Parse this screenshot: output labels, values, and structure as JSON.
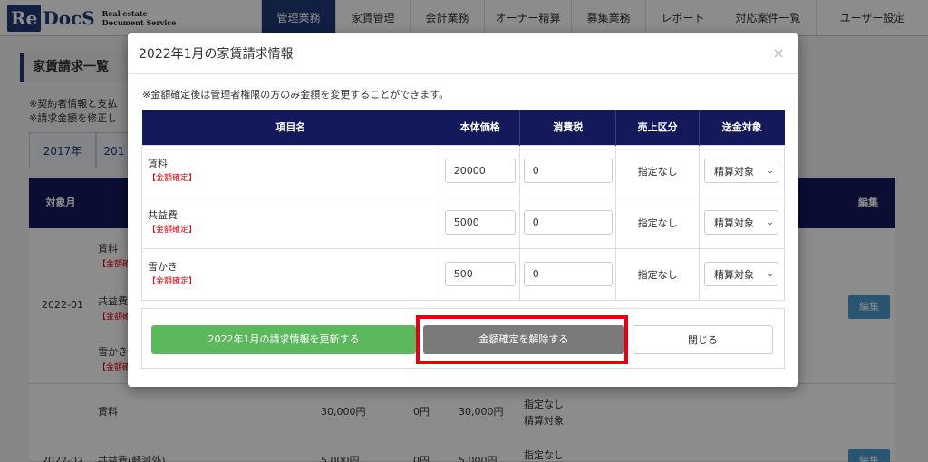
{
  "app": {
    "logo_mark": "Re",
    "logo_text": "DocS",
    "logo_sub_line1": "Real estate",
    "logo_sub_line2": "Document Service"
  },
  "nav": {
    "items": [
      {
        "label": "管理業務",
        "active": true
      },
      {
        "label": "家賃管理",
        "active": false
      },
      {
        "label": "会計業務",
        "active": false
      },
      {
        "label": "オーナー精算",
        "active": false
      },
      {
        "label": "募集業務",
        "active": false
      },
      {
        "label": "レポート",
        "active": false
      },
      {
        "label": "対応案件一覧",
        "active": false
      },
      {
        "label": "ユーザー設定",
        "active": false
      }
    ]
  },
  "background": {
    "page_title": "家賃請求一覧",
    "note1": "※契約者情報と支払",
    "note2": "※請求金額を修正し",
    "years": [
      "2017年",
      "201"
    ],
    "th_month": "対象月",
    "th_edit": "編集",
    "month1": "2022-01",
    "month2": "2022-02",
    "edit_label": "編集",
    "row1_items": [
      "賃料",
      "【金額確",
      "共益費",
      "【金額確",
      "雪かき",
      "【金額確"
    ],
    "row2_item1": "賃料",
    "row2_price1": "30,000円",
    "row2_tax1": "0円",
    "row2_total1": "30,000円",
    "row2_cat1a": "指定なし",
    "row2_cat1b": "精算対象",
    "row2_item2": "共益費(軽減外)",
    "row2_price2": "5,000円",
    "row2_tax2": "0円",
    "row2_total2": "5,000円",
    "row2_cat2": "指定なし"
  },
  "modal": {
    "title": "2022年1月の家賃請求情報",
    "close_symbol": "×",
    "notice": "※金額確定後は管理者権限の方のみ金額を変更することができます。",
    "headers": {
      "name": "項目名",
      "price": "本体価格",
      "tax": "消費税",
      "category": "売上区分",
      "destination": "送金対象"
    },
    "rows": [
      {
        "name": "賃料",
        "flag": "【金額確定】",
        "price": "20000",
        "tax": "0",
        "category": "指定なし",
        "destination": "精算対象"
      },
      {
        "name": "共益費",
        "flag": "【金額確定】",
        "price": "5000",
        "tax": "0",
        "category": "指定なし",
        "destination": "精算対象"
      },
      {
        "name": "雪かき",
        "flag": "【金額確定】",
        "price": "500",
        "tax": "0",
        "category": "指定なし",
        "destination": "精算対象"
      }
    ],
    "buttons": {
      "update": "2022年1月の請求情報を更新する",
      "unlock": "金額確定を解除する",
      "close": "閉じる"
    }
  },
  "colors": {
    "navy": "#14195c",
    "brand": "#1e3a78",
    "green": "#5cb85c",
    "gray_button": "#7a7a7a",
    "highlight_red": "#e60012"
  }
}
